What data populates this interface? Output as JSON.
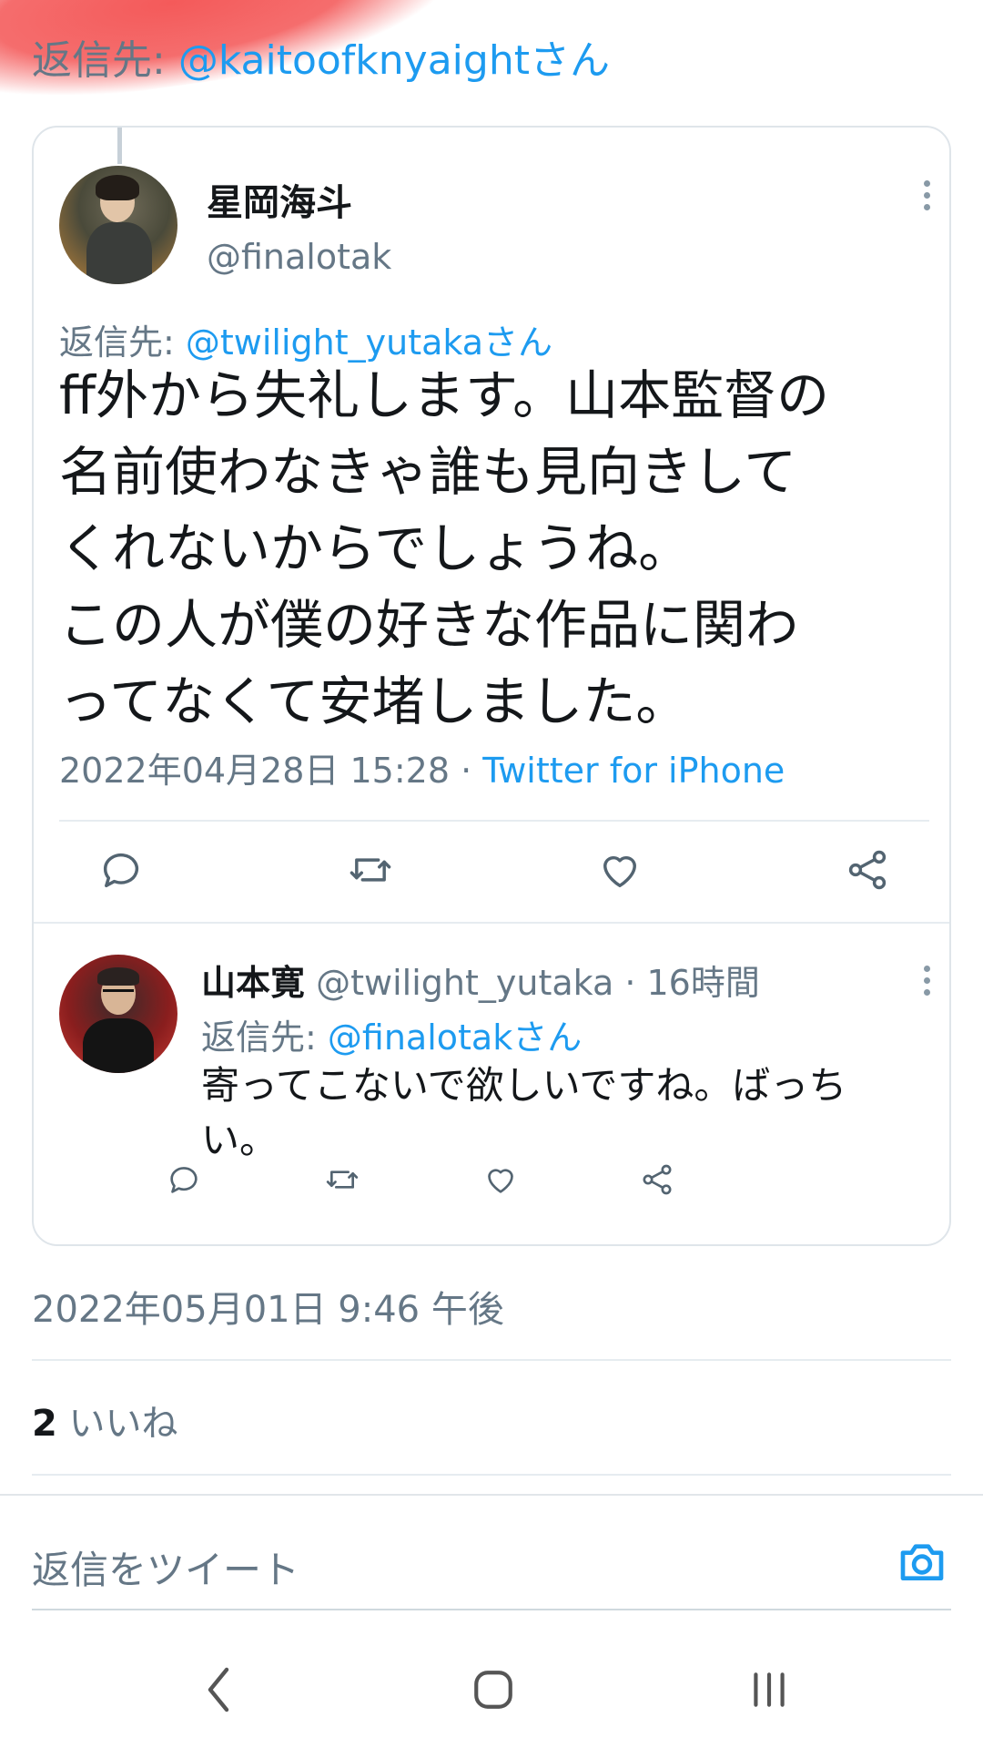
{
  "reply_to_top": {
    "prefix": "返信先: ",
    "mention": "@kaitoofknyaightさん"
  },
  "quoted_tweet": {
    "author_name": "星岡海斗",
    "author_handle": "@finalotak",
    "reply_prefix": "返信先: ",
    "reply_mention": "@twilight_yutakaさん",
    "text_lines": [
      "ff外から失礼します。山本監督の",
      "名前使わなきゃ誰も見向きして",
      "くれないからでしょうね。",
      "この人が僕の好きな作品に関わ",
      "ってなくて安堵しました。"
    ],
    "timestamp": "2022年04月28日 15:28",
    "separator": " · ",
    "source": "Twitter for iPhone"
  },
  "reply_tweet": {
    "author_name": "山本寛",
    "author_handle": "@twilight_yutaka",
    "time_suffix": " · 16時間",
    "reply_prefix": "返信先: ",
    "reply_mention": "@finalotakさん",
    "text_lines": [
      "寄ってこないで欲しいですね。ばっち",
      "い。"
    ]
  },
  "main_timestamp": "2022年05月01日 9:46 午後",
  "likes": {
    "count": "2",
    "label": " いいね"
  },
  "reply_input": {
    "placeholder": "返信をツイート"
  },
  "icons": {
    "reply": "reply-icon",
    "retweet": "retweet-icon",
    "like": "heart-icon",
    "share": "share-icon",
    "camera": "camera-icon",
    "back": "back-icon",
    "home": "home-icon",
    "recents": "recents-icon"
  },
  "colors": {
    "accent": "#1d9bf0",
    "secondary_text": "#657786",
    "primary_text": "#14171a"
  }
}
